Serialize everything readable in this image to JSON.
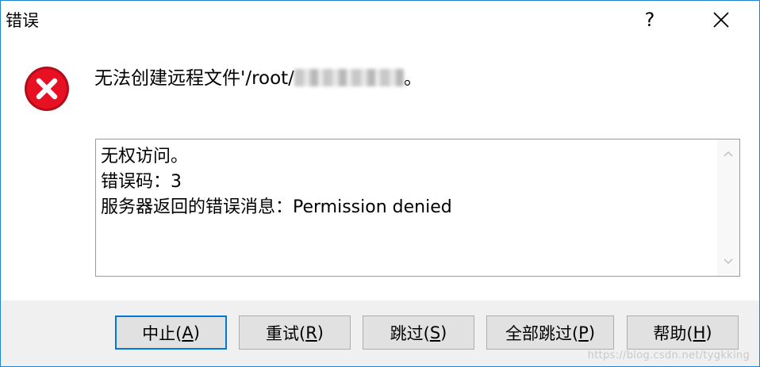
{
  "window": {
    "title": "错误",
    "help_label": "?",
    "close_icon": "close-icon"
  },
  "message": {
    "prefix": "无法创建远程文件'/root/",
    "suffix": "。"
  },
  "details": {
    "line1": "无权访问。",
    "line2": "错误码：3",
    "line3": "服务器返回的错误消息：Permission denied"
  },
  "buttons": [
    {
      "text": "中止(",
      "key": "A",
      "end": ")"
    },
    {
      "text": "重试(",
      "key": "R",
      "end": ")"
    },
    {
      "text": "跳过(",
      "key": "S",
      "end": ")"
    },
    {
      "text": "全部跳过(",
      "key": "P",
      "end": ")"
    },
    {
      "text": "帮助(",
      "key": "H",
      "end": ")"
    }
  ],
  "watermark": "https://blog.csdn.net/tygkking",
  "colors": {
    "accent": "#0078d7",
    "error_red": "#e81123"
  }
}
